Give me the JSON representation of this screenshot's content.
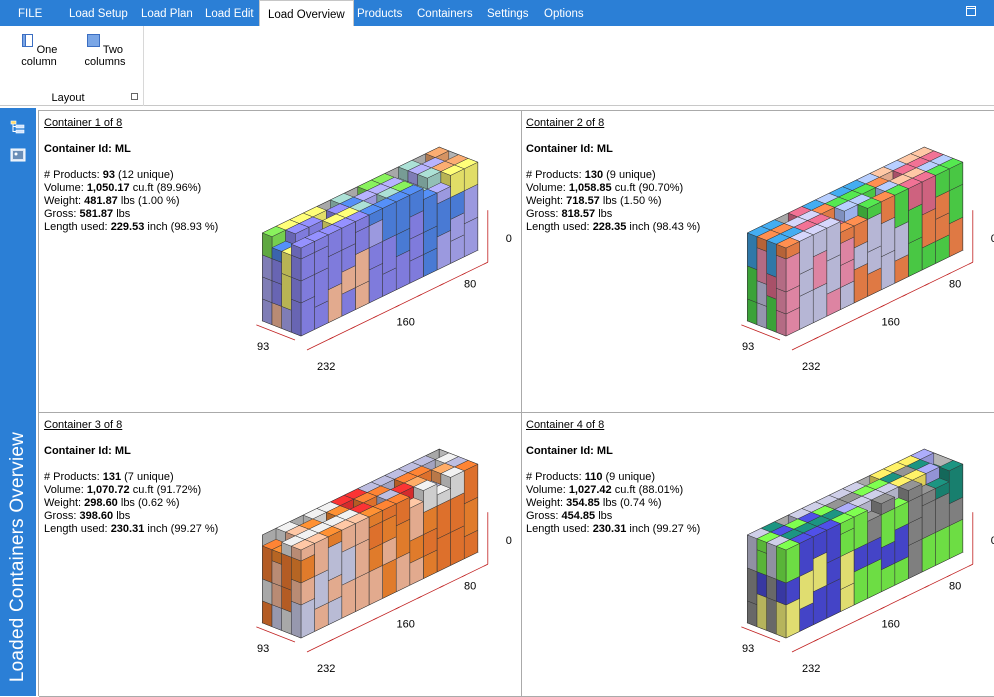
{
  "menu": {
    "file": "FILE",
    "tabs": [
      "Load Setup",
      "Load Plan",
      "Load Edit",
      "Load Overview",
      "Products",
      "Containers",
      "Settings",
      "Options"
    ],
    "active": "Load Overview"
  },
  "ribbon": {
    "one_column": "One column",
    "two_columns": "Two columns",
    "group_label": "Layout"
  },
  "sidepanel": {
    "title": "Loaded Containers Overview"
  },
  "containers": [
    {
      "title": "Container 1 of 8",
      "id_label": "Container Id:",
      "id": "ML",
      "products_label": "# Products:",
      "products": "93",
      "unique": "(12 unique)",
      "volume_label": "Volume:",
      "volume": "1,050.17",
      "volume_unit": "cu.ft",
      "volume_pct": "(89.96%)",
      "weight_label": "Weight:",
      "weight": "481.87",
      "weight_unit": "lbs",
      "weight_pct": "(1.00 %)",
      "gross_label": "Gross:",
      "gross": "581.87",
      "gross_unit": "lbs",
      "length_label": "Length used:",
      "length": "229.53",
      "length_unit": "inch",
      "length_pct": "(98.93 %)",
      "axis": {
        "width": "93",
        "length": "232",
        "mid": "160",
        "height": "80",
        "zero": "0"
      }
    },
    {
      "title": "Container 2 of 8",
      "id_label": "Container Id:",
      "id": "ML",
      "products_label": "# Products:",
      "products": "130",
      "unique": "(9 unique)",
      "volume_label": "Volume:",
      "volume": "1,058.85",
      "volume_unit": "cu.ft",
      "volume_pct": "(90.70%)",
      "weight_label": "Weight:",
      "weight": "718.57",
      "weight_unit": "lbs",
      "weight_pct": "(1.50 %)",
      "gross_label": "Gross:",
      "gross": "818.57",
      "gross_unit": "lbs",
      "length_label": "Length used:",
      "length": "228.35",
      "length_unit": "inch",
      "length_pct": "(98.43 %)",
      "axis": {
        "width": "93",
        "length": "232",
        "mid": "160",
        "height": "80",
        "zero": "0"
      }
    },
    {
      "title": "Container 3 of 8",
      "id_label": "Container Id:",
      "id": "ML",
      "products_label": "# Products:",
      "products": "131",
      "unique": "(7 unique)",
      "volume_label": "Volume:",
      "volume": "1,070.72",
      "volume_unit": "cu.ft",
      "volume_pct": "(91.72%)",
      "weight_label": "Weight:",
      "weight": "298.60",
      "weight_unit": "lbs",
      "weight_pct": "(0.62 %)",
      "gross_label": "Gross:",
      "gross": "398.60",
      "gross_unit": "lbs",
      "length_label": "Length used:",
      "length": "230.31",
      "length_unit": "inch",
      "length_pct": "(99.27 %)",
      "axis": {
        "width": "93",
        "length": "232",
        "mid": "160",
        "height": "80",
        "zero": "0"
      }
    },
    {
      "title": "Container 4 of 8",
      "id_label": "Container Id:",
      "id": "ML",
      "products_label": "# Products:",
      "products": "110",
      "unique": "(9 unique)",
      "volume_label": "Volume:",
      "volume": "1,027.42",
      "volume_unit": "cu.ft",
      "volume_pct": "(88.01%)",
      "weight_label": "Weight:",
      "weight": "354.85",
      "weight_unit": "lbs",
      "weight_pct": "(0.74 %)",
      "gross_label": "Gross:",
      "gross": "454.85",
      "gross_unit": "lbs",
      "length_label": "Length used:",
      "length": "230.31",
      "length_unit": "inch",
      "length_pct": "(99.27 %)",
      "axis": {
        "width": "93",
        "length": "232",
        "mid": "160",
        "height": "80",
        "zero": "0"
      }
    }
  ],
  "palettes": [
    [
      "#f6b99a",
      "#8a86ef",
      "#4f85e6",
      "#a9a6f2",
      "#f5f070",
      "#7fe056",
      "#9fd0c6",
      "#e8a06a"
    ],
    [
      "#f08fb0",
      "#c6c6e8",
      "#f2844a",
      "#4fd84a",
      "#e06a8a",
      "#3fa0e0",
      "#aac0ff",
      "#f6b99a"
    ],
    [
      "#c9cbe8",
      "#f6b99a",
      "#f3862f",
      "#f07a30",
      "#e0e0e0",
      "#e83030",
      "#b0b0d0",
      "#f6a060"
    ],
    [
      "#f3f07a",
      "#4a4ad8",
      "#76f04a",
      "#8a8a8a",
      "#1a8a78",
      "#c0c0d8",
      "#a0a0e8",
      "#f0e060"
    ]
  ],
  "colors": {
    "accent": "#2b7fd6"
  }
}
